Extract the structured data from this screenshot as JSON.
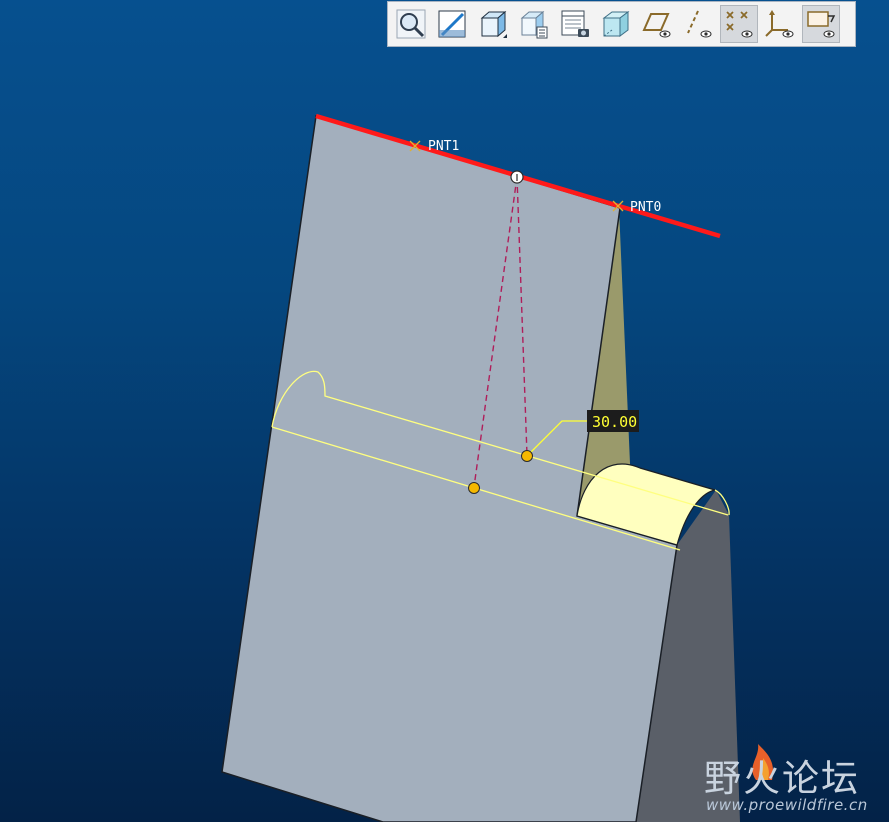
{
  "toolbar": {
    "buttons": [
      {
        "icon": "zoom-magnifier-icon"
      },
      {
        "icon": "sketch-icon"
      },
      {
        "icon": "shaded-cube-icon"
      },
      {
        "icon": "view-manager-icon"
      },
      {
        "icon": "layer-tree-icon"
      },
      {
        "icon": "hidden-line-cube-icon"
      },
      {
        "icon": "datum-plane-display-icon"
      },
      {
        "icon": "datum-axis-display-icon"
      },
      {
        "icon": "datum-point-display-icon",
        "active": true
      },
      {
        "icon": "coordinate-system-display-icon"
      },
      {
        "icon": "annotation-display-icon",
        "active": true
      }
    ]
  },
  "model": {
    "point_labels": {
      "pnt1": "PNT1",
      "pnt0": "PNT0"
    },
    "dimension_value": "30.00",
    "colors": {
      "face": "#a3afbd",
      "dark_face": "#5a5f68",
      "olive_face": "#9a9a6b",
      "highlight": "#ffffbf",
      "axis_line": "#ff1a1a",
      "preview_edge": "#ffff80",
      "dimension_text": "#ffff33",
      "handle": "#f5b800",
      "dashed": "#b01e5a"
    }
  },
  "watermark": {
    "title": "野火论坛",
    "url": "www.proewildfire.cn"
  }
}
